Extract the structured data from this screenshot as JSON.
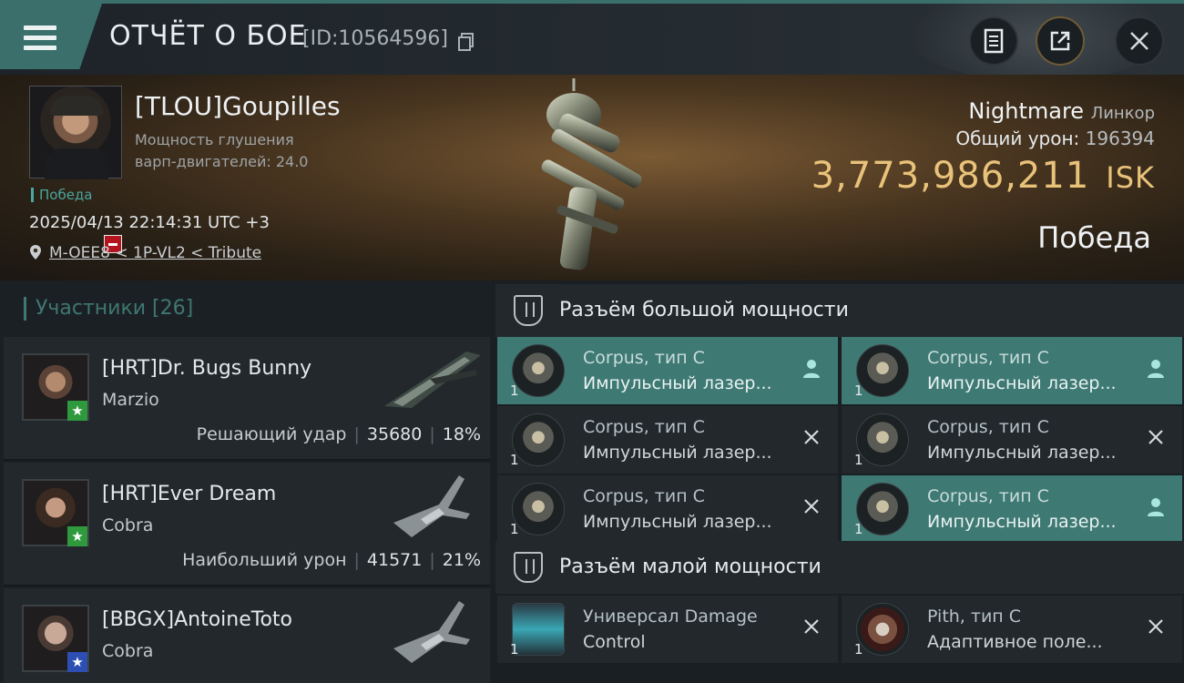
{
  "header": {
    "title": "ОТЧЁТ О БОЕ",
    "report_id": "[ID:10564596]"
  },
  "victim": {
    "name": "[TLOU]Goupilles",
    "jam_line1": "Мощность глушения",
    "jam_line2": "варп-двигателей: 24.0",
    "outcome_tag": "Победа",
    "datetime": "2025/04/13 22:14:31 UTC +3",
    "location": "M-OEE8 < 1P-VL2 < Tribute",
    "ship": "Nightmare",
    "ship_class": "Линкор",
    "damage_label": "Общий урон:",
    "damage_value": "196394",
    "isk_value": "3,773,986,211",
    "isk_unit": "ISK",
    "result": "Победа"
  },
  "participants": {
    "title": "Участники [26]",
    "rows": [
      {
        "name": "[HRT]Dr. Bugs Bunny",
        "ship": "Marzio",
        "stat_label": "Решающий удар",
        "damage": "35680",
        "percent": "18%",
        "badge": "green"
      },
      {
        "name": "[HRT]Ever Dream",
        "ship": "Cobra",
        "stat_label": "Наибольший урон",
        "damage": "41571",
        "percent": "21%",
        "badge": "green"
      },
      {
        "name": "[BBGX]AntoineToto",
        "ship": "Cobra",
        "stat_label": "",
        "damage": "",
        "percent": "",
        "badge": "blue"
      }
    ]
  },
  "fitting": {
    "high_title": "Разъём большой мощности",
    "low_title": "Разъём малой мощности",
    "high": [
      {
        "l1": "Corpus, тип C",
        "l2": "Импульсный лазер...",
        "qty": "1",
        "hl": true,
        "action": "user"
      },
      {
        "l1": "Corpus, тип C",
        "l2": "Импульсный лазер...",
        "qty": "1",
        "hl": false,
        "action": "close"
      },
      {
        "l1": "Corpus, тип C",
        "l2": "Импульсный лазер...",
        "qty": "1",
        "hl": false,
        "action": "close"
      },
      {
        "l1": "Corpus, тип C",
        "l2": "Импульсный лазер...",
        "qty": "1",
        "hl": true,
        "action": "user"
      },
      {
        "l1": "Corpus, тип C",
        "l2": "Импульсный лазер...",
        "qty": "1",
        "hl": false,
        "action": "close"
      },
      {
        "l1": "Corpus, тип C",
        "l2": "Импульсный лазер...",
        "qty": "1",
        "hl": true,
        "action": "user"
      }
    ],
    "low": [
      {
        "l1": "Универсал Damage",
        "l2": "Control",
        "qty": "1",
        "hl": false,
        "action": "close"
      },
      {
        "l1": "Pith, тип C",
        "l2": "Адаптивное поле...",
        "qty": "1",
        "hl": false,
        "action": "close"
      }
    ]
  },
  "colors": {
    "accent": "#3e7974",
    "isk": "#e9c27a",
    "kill_badge": "#b3141e"
  }
}
